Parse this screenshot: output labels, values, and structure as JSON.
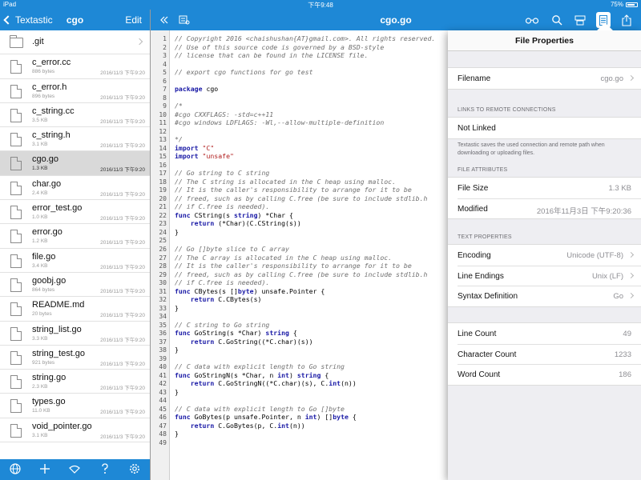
{
  "status_bar": {
    "device": "iPad",
    "time": "下午9:48",
    "battery": "75%"
  },
  "sidebar": {
    "back_label": "Textastic",
    "title": "cgo",
    "edit_label": "Edit",
    "folder": {
      "name": ".git"
    },
    "files": [
      {
        "name": "c_error.cc",
        "size": "886 bytes",
        "date": "2016/11/3 下午9:20"
      },
      {
        "name": "c_error.h",
        "size": "896 bytes",
        "date": "2016/11/3 下午9:20"
      },
      {
        "name": "c_string.cc",
        "size": "3.5 KB",
        "date": "2016/11/3 下午9:20"
      },
      {
        "name": "c_string.h",
        "size": "3.1 KB",
        "date": "2016/11/3 下午9:20"
      },
      {
        "name": "cgo.go",
        "size": "1.3 KB",
        "date": "2016/11/3 下午9:20",
        "selected": true
      },
      {
        "name": "char.go",
        "size": "2.4 KB",
        "date": "2016/11/3 下午9:20"
      },
      {
        "name": "error_test.go",
        "size": "1.0 KB",
        "date": "2016/11/3 下午9:20"
      },
      {
        "name": "error.go",
        "size": "1.2 KB",
        "date": "2016/11/3 下午9:20"
      },
      {
        "name": "file.go",
        "size": "3.4 KB",
        "date": "2016/11/3 下午9:20"
      },
      {
        "name": "goobj.go",
        "size": "864 bytes",
        "date": "2016/11/3 下午9:20"
      },
      {
        "name": "README.md",
        "size": "20 bytes",
        "date": "2016/11/3 下午9:20"
      },
      {
        "name": "string_list.go",
        "size": "3.3 KB",
        "date": "2016/11/3 下午9:20"
      },
      {
        "name": "string_test.go",
        "size": "921 bytes",
        "date": "2016/11/3 下午9:20"
      },
      {
        "name": "string.go",
        "size": "2.3 KB",
        "date": "2016/11/3 下午9:20"
      },
      {
        "name": "types.go",
        "size": "11.0 KB",
        "date": "2016/11/3 下午9:20"
      },
      {
        "name": "void_pointer.go",
        "size": "3.1 KB",
        "date": "2016/11/3 下午9:20"
      }
    ],
    "toolbar_icons": [
      "globe-icon",
      "plus-icon",
      "wifi-icon",
      "help-icon",
      "settings-icon"
    ]
  },
  "editor": {
    "title": "cgo.go",
    "nav_icons": [
      "collapse-sidebar-icon",
      "symbols-icon",
      "glasses-icon",
      "search-icon",
      "keyboard-icon",
      "file-info-icon",
      "share-icon"
    ],
    "lines": [
      "// Copyright 2016 <chaishushan{AT}gmail.com>. All rights reserved.",
      "// Use of this source code is governed by a BSD-style",
      "// license that can be found in the LICENSE file.",
      "",
      "// export cgo functions for go test",
      "",
      "package cgo",
      "",
      "/*",
      "#cgo CXXFLAGS: -std=c++11",
      "#cgo windows LDFLAGS: -Wl,--allow-multiple-definition",
      "",
      "*/",
      "import \"C\"",
      "import \"unsafe\"",
      "",
      "// Go string to C string",
      "// The C string is allocated in the C heap using malloc.",
      "// It is the caller's responsibility to arrange for it to be",
      "// freed, such as by calling C.free (be sure to include stdlib.h",
      "// if C.free is needed).",
      "func CString(s string) *Char {",
      "    return (*Char)(C.CString(s))",
      "}",
      "",
      "// Go []byte slice to C array",
      "// The C array is allocated in the C heap using malloc.",
      "// It is the caller's responsibility to arrange for it to be",
      "// freed, such as by calling C.free (be sure to include stdlib.h",
      "// if C.free is needed).",
      "func CBytes(s []byte) unsafe.Pointer {",
      "    return C.CBytes(s)",
      "}",
      "",
      "// C string to Go string",
      "func GoString(s *Char) string {",
      "    return C.GoString((*C.char)(s))",
      "}",
      "",
      "// C data with explicit length to Go string",
      "func GoStringN(s *Char, n int) string {",
      "    return C.GoStringN((*C.char)(s), C.int(n))",
      "}",
      "",
      "// C data with explicit length to Go []byte",
      "func GoBytes(p unsafe.Pointer, n int) []byte {",
      "    return C.GoBytes(p, C.int(n))",
      "}",
      ""
    ]
  },
  "popover": {
    "title": "File Properties",
    "filename_label": "Filename",
    "filename_value": "cgo.go",
    "links_header": "LINKS TO REMOTE CONNECTIONS",
    "not_linked": "Not Linked",
    "links_note": "Textastic saves the used connection and remote path when downloading or uploading files.",
    "attributes_header": "FILE ATTRIBUTES",
    "file_size_label": "File Size",
    "file_size_value": "1.3 KB",
    "modified_label": "Modified",
    "modified_value": "2016年11月3日 下午9:20:36",
    "text_header": "TEXT PROPERTIES",
    "encoding_label": "Encoding",
    "encoding_value": "Unicode (UTF-8)",
    "line_endings_label": "Line Endings",
    "line_endings_value": "Unix (LF)",
    "syntax_label": "Syntax Definition",
    "syntax_value": "Go",
    "line_count_label": "Line Count",
    "line_count_value": "49",
    "char_count_label": "Character Count",
    "char_count_value": "1233",
    "word_count_label": "Word Count",
    "word_count_value": "186"
  }
}
